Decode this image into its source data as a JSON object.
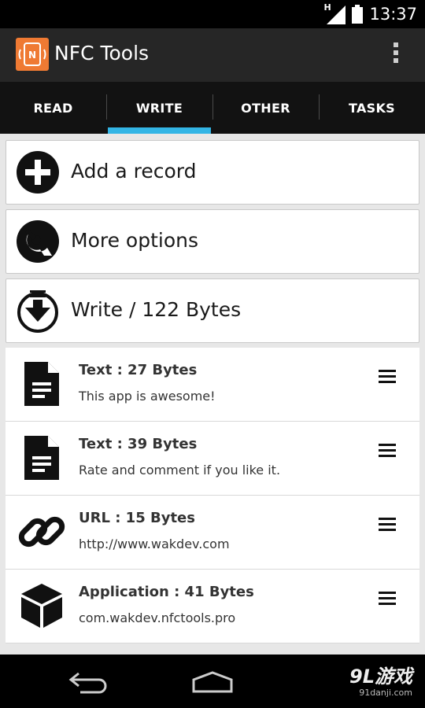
{
  "status_bar": {
    "network_label": "H",
    "time": "13:37"
  },
  "app": {
    "title": "NFC Tools",
    "icon_letter": "N",
    "accent": "#ef7a33"
  },
  "tabs": [
    {
      "label": "READ",
      "active": false
    },
    {
      "label": "WRITE",
      "active": true
    },
    {
      "label": "OTHER",
      "active": false
    },
    {
      "label": "TASKS",
      "active": false
    }
  ],
  "tab_indicator_color": "#33b5e5",
  "actions": {
    "add": {
      "label": "Add a record",
      "icon": "plus-circle-icon"
    },
    "options": {
      "label": "More options",
      "icon": "wrench-icon"
    },
    "write": {
      "label": "Write / 122 Bytes",
      "icon": "download-circle-icon"
    }
  },
  "records": [
    {
      "title": "Text : 27 Bytes",
      "subtitle": "This app is awesome!",
      "icon": "document-icon"
    },
    {
      "title": "Text : 39 Bytes",
      "subtitle": "Rate and comment if you like it.",
      "icon": "document-icon"
    },
    {
      "title": "URL : 15 Bytes",
      "subtitle": "http://www.wakdev.com",
      "icon": "link-icon"
    },
    {
      "title": "Application : 41 Bytes",
      "subtitle": "com.wakdev.nfctools.pro",
      "icon": "cube-icon"
    }
  ],
  "watermark": {
    "main": "9L游戏",
    "sub": "91danji.com"
  }
}
